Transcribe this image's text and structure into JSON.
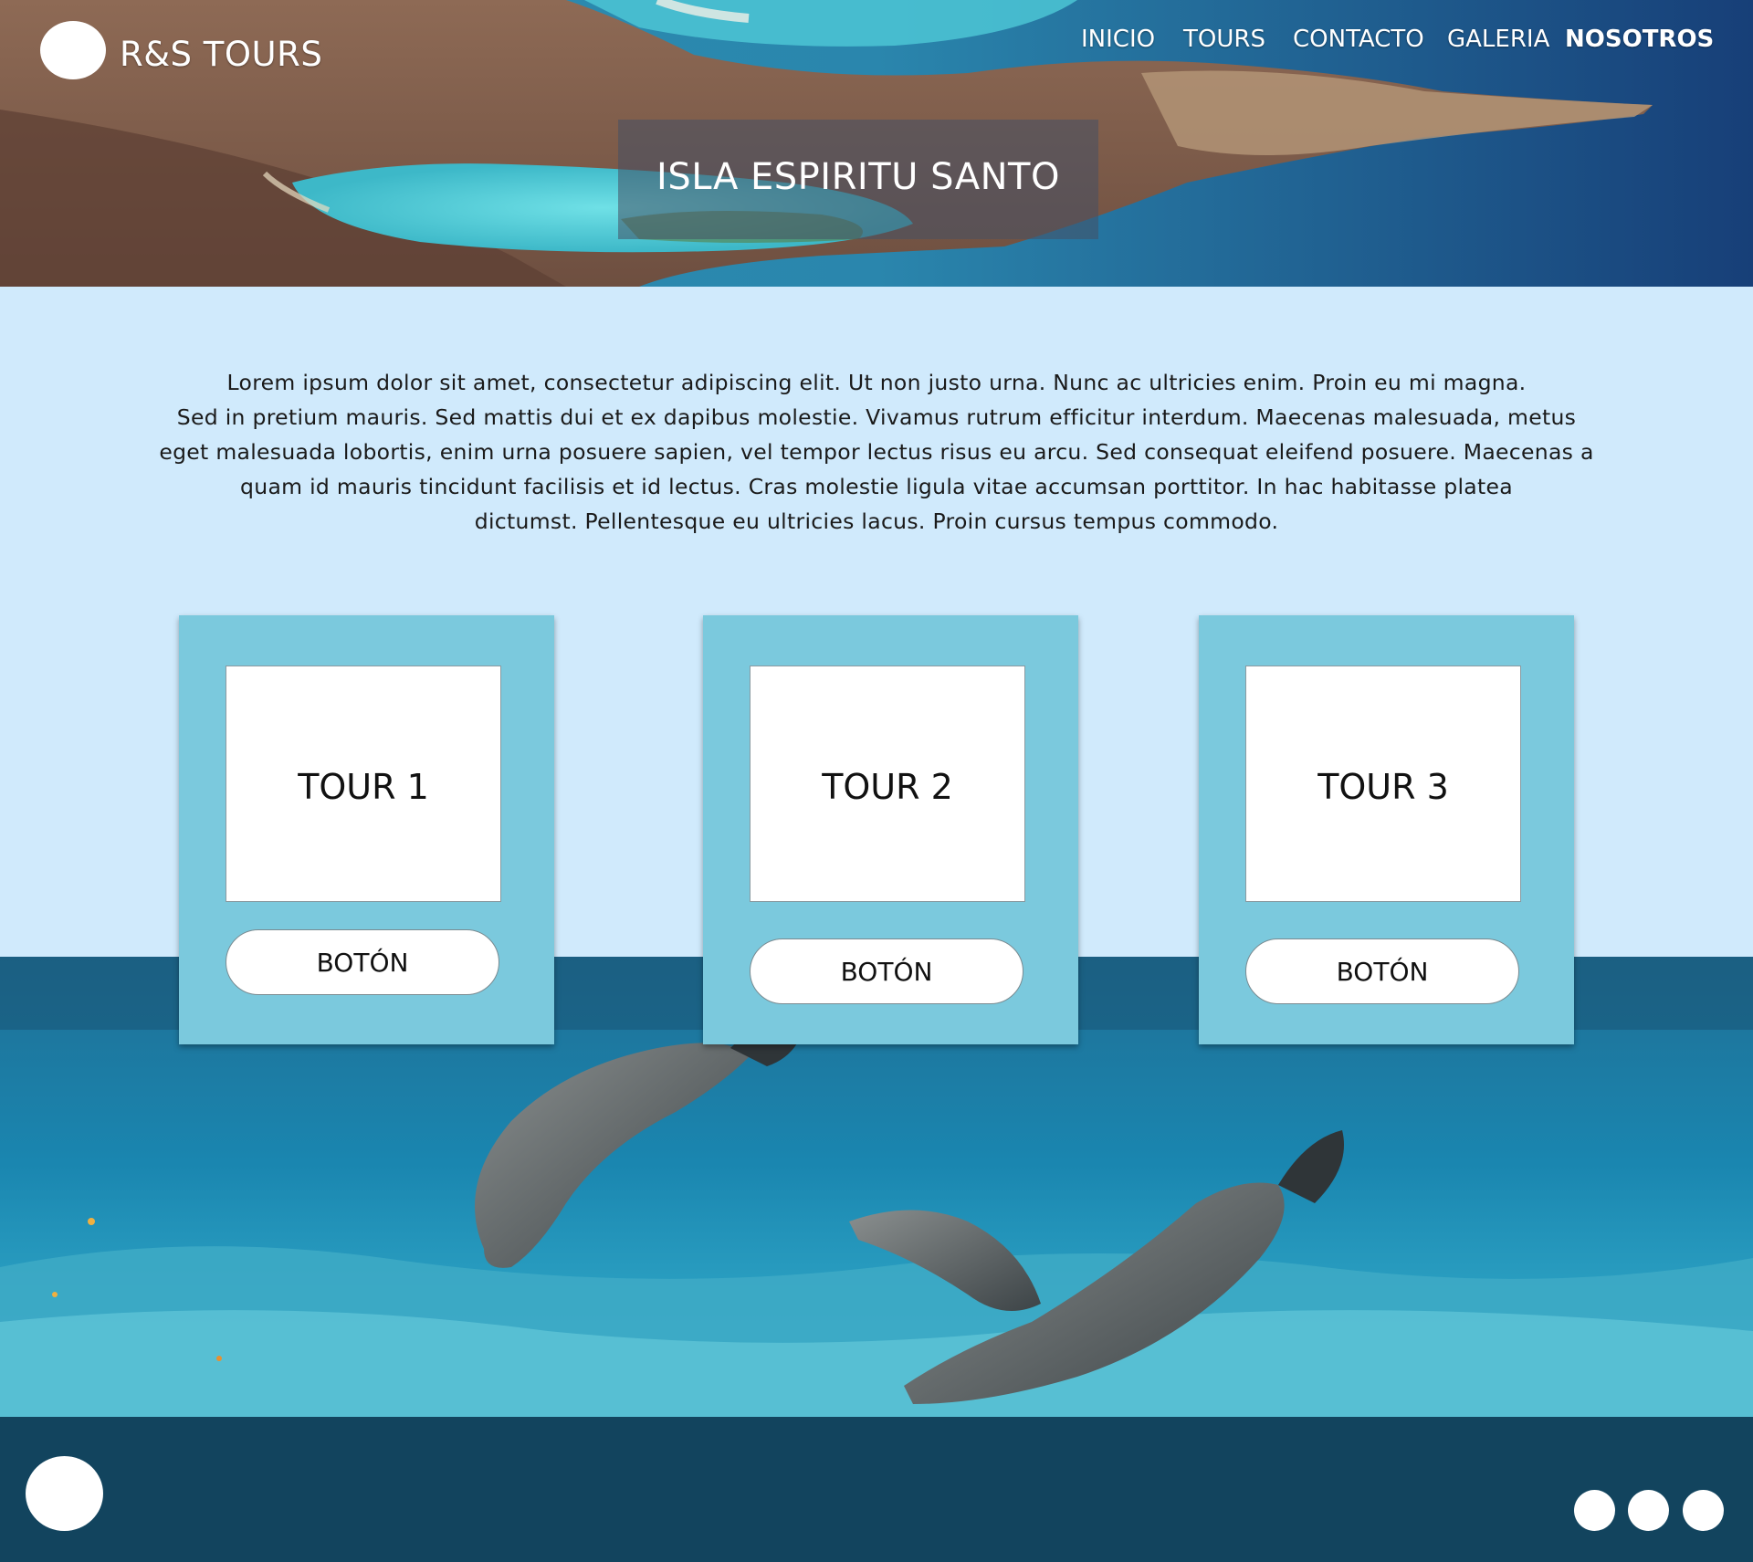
{
  "header": {
    "brand": "R&S TOURS",
    "nav": [
      "INICIO",
      "TOURS",
      "CONTACTO",
      "GALERIA",
      "NOSOTROS"
    ],
    "hero_title": "ISLA ESPIRITU SANTO"
  },
  "intro": {
    "line1": "Lorem ipsum dolor sit amet, consectetur adipiscing elit. Ut non justo urna. Nunc ac ultricies enim. Proin eu mi magna.",
    "line2": "Sed in pretium mauris. Sed mattis dui et ex dapibus molestie. Vivamus rutrum efficitur interdum. Maecenas malesuada, metus",
    "line3": "eget malesuada lobortis, enim urna posuere sapien, vel tempor lectus risus eu arcu. Sed consequat eleifend posuere. Maecenas a",
    "line4": "quam id mauris tincidunt facilisis et id lectus. Cras molestie ligula vitae accumsan porttitor. In hac habitasse platea",
    "line5": "dictumst. Pellentesque eu ultricies lacus. Proin cursus tempus commodo."
  },
  "cards": [
    {
      "title": "TOUR 1",
      "button": "BOTÓN"
    },
    {
      "title": "TOUR 2",
      "button": "BOTÓN"
    },
    {
      "title": "TOUR 3",
      "button": "BOTÓN"
    }
  ],
  "colors": {
    "page_bg": "#d0eafc",
    "card_bg": "#7bc9dd",
    "footer_bg": "#12445e",
    "white": "#ffffff"
  }
}
